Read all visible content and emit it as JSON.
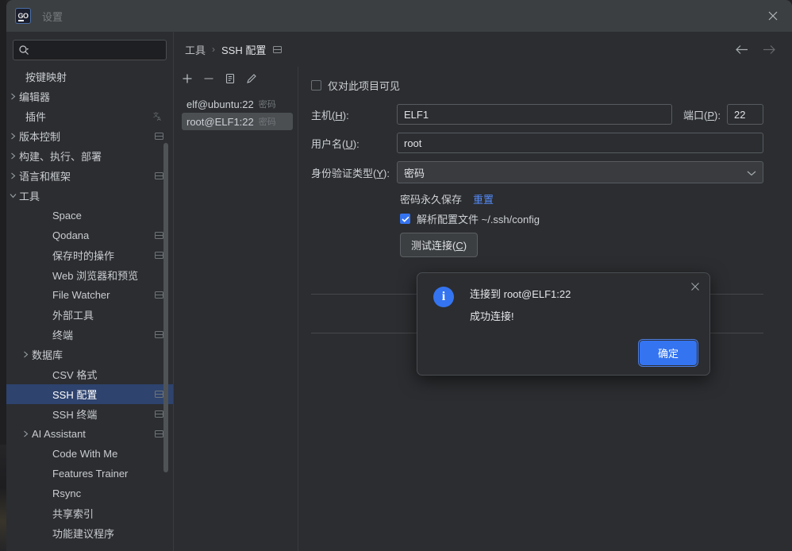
{
  "window": {
    "title": "设置",
    "logo_text": "GO",
    "close_label": "×"
  },
  "search": {
    "placeholder": "",
    "value": "",
    "icon": "search-icon"
  },
  "sidebar": {
    "items": [
      {
        "label": "按键映射",
        "level": 0,
        "arrow": "",
        "trail": "",
        "selected": false
      },
      {
        "label": "编辑器",
        "level": 0,
        "arrow": "collapsed",
        "trail": "",
        "selected": false
      },
      {
        "label": "插件",
        "level": 0,
        "arrow": "",
        "trail": "translate",
        "selected": false
      },
      {
        "label": "版本控制",
        "level": 0,
        "arrow": "collapsed",
        "trail": "project",
        "selected": false
      },
      {
        "label": "构建、执行、部署",
        "level": 0,
        "arrow": "collapsed",
        "trail": "",
        "selected": false
      },
      {
        "label": "语言和框架",
        "level": 0,
        "arrow": "collapsed",
        "trail": "project",
        "selected": false
      },
      {
        "label": "工具",
        "level": 0,
        "arrow": "expanded",
        "trail": "",
        "selected": false
      },
      {
        "label": "Space",
        "level": 1,
        "arrow": "",
        "trail": "",
        "selected": false
      },
      {
        "label": "Qodana",
        "level": 1,
        "arrow": "",
        "trail": "project",
        "selected": false
      },
      {
        "label": "保存时的操作",
        "level": 1,
        "arrow": "",
        "trail": "project",
        "selected": false
      },
      {
        "label": "Web 浏览器和预览",
        "level": 1,
        "arrow": "",
        "trail": "",
        "selected": false
      },
      {
        "label": "File Watcher",
        "level": 1,
        "arrow": "",
        "trail": "project",
        "selected": false
      },
      {
        "label": "外部工具",
        "level": 1,
        "arrow": "",
        "trail": "",
        "selected": false
      },
      {
        "label": "终端",
        "level": 1,
        "arrow": "",
        "trail": "project",
        "selected": false
      },
      {
        "label": "数据库",
        "level": 1,
        "arrow": "collapsed",
        "trail": "",
        "selected": false
      },
      {
        "label": "CSV 格式",
        "level": 1,
        "arrow": "",
        "trail": "",
        "selected": false
      },
      {
        "label": "SSH 配置",
        "level": 1,
        "arrow": "",
        "trail": "project",
        "selected": true
      },
      {
        "label": "SSH 终端",
        "level": 1,
        "arrow": "",
        "trail": "project",
        "selected": false
      },
      {
        "label": "AI Assistant",
        "level": 1,
        "arrow": "collapsed",
        "trail": "project",
        "selected": false
      },
      {
        "label": "Code With Me",
        "level": 1,
        "arrow": "",
        "trail": "",
        "selected": false
      },
      {
        "label": "Features Trainer",
        "level": 1,
        "arrow": "",
        "trail": "",
        "selected": false
      },
      {
        "label": "Rsync",
        "level": 1,
        "arrow": "",
        "trail": "",
        "selected": false
      },
      {
        "label": "共享索引",
        "level": 1,
        "arrow": "",
        "trail": "",
        "selected": false
      },
      {
        "label": "功能建议程序",
        "level": 1,
        "arrow": "",
        "trail": "",
        "selected": false
      }
    ]
  },
  "breadcrumb": {
    "parent": "工具",
    "separator": "›",
    "current": "SSH 配置",
    "badge_icon": "project-scope-icon"
  },
  "nav": {
    "back_icon": "arrow-left-icon",
    "forward_icon": "arrow-right-icon"
  },
  "list_toolbar": {
    "add_icon": "plus-icon",
    "remove_icon": "minus-icon",
    "copy_icon": "copy-icon",
    "edit_icon": "pencil-icon"
  },
  "ssh_configs": [
    {
      "name": "elf@ubuntu:22",
      "auth": "密码",
      "selected": false
    },
    {
      "name": "root@ELF1:22",
      "auth": "密码",
      "selected": true
    }
  ],
  "form": {
    "visible_only_label": "仅对此项目可见",
    "visible_only_checked": false,
    "host_label": "主机(H):",
    "host_mnemonic": "H",
    "host_value": "ELF1",
    "port_label": "端口(P):",
    "port_mnemonic": "P",
    "port_value": "22",
    "user_label": "用户名(U):",
    "user_mnemonic": "U",
    "user_value": "root",
    "auth_label": "身份验证类型(Y):",
    "auth_mnemonic": "Y",
    "auth_value": "密码",
    "auth_chevron": "chevron-down-icon",
    "save_password_label": "密码永久保存",
    "reset_link": "重置",
    "parse_config_label": "解析配置文件 ~/.ssh/config",
    "parse_config_checked": true,
    "test_connection_label": "测试连接(C)",
    "test_connection_mnemonic": "C"
  },
  "dialog": {
    "icon": "info-icon",
    "line1": "连接到 root@ELF1:22",
    "line2": "成功连接!",
    "ok_label": "确定",
    "close_icon": "close-icon"
  },
  "colors": {
    "accent": "#3574f0",
    "selection": "#2e436e",
    "link": "#548af7",
    "window_bg": "#2b2d30",
    "titlebar_bg": "#3c3f41"
  }
}
